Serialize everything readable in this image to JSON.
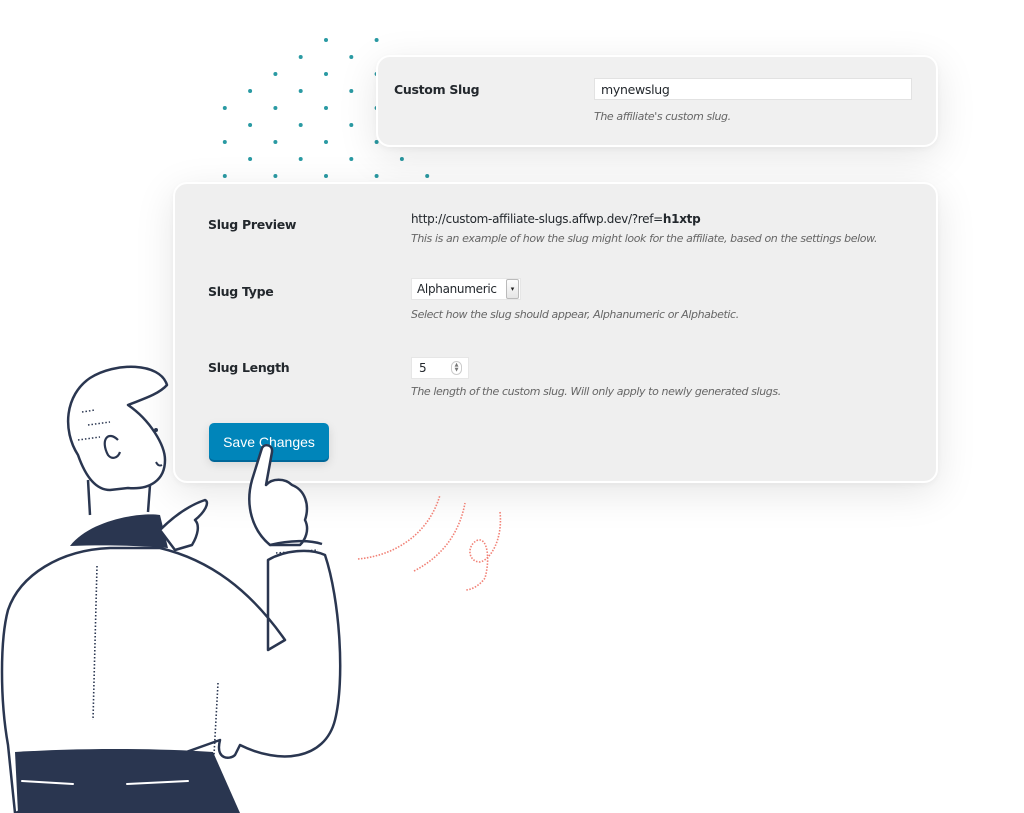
{
  "colors": {
    "accent": "#0085ba",
    "dots": "#2a9aa3",
    "figure_outline": "#2a3650",
    "motion_lines": "#ef6b5e"
  },
  "custom_slug": {
    "label": "Custom Slug",
    "value": "mynewslug",
    "description": "The affiliate's custom slug."
  },
  "settings": {
    "slug_preview": {
      "label": "Slug Preview",
      "url_prefix": "http://custom-affiliate-slugs.affwp.dev/?ref=",
      "url_ref": "h1xtp",
      "description": "This is an example of how the slug might look for the affiliate, based on the settings below."
    },
    "slug_type": {
      "label": "Slug Type",
      "selected": "Alphanumeric",
      "description": "Select how the slug should appear, Alphanumeric or Alphabetic."
    },
    "slug_length": {
      "label": "Slug Length",
      "value": "5",
      "description": "The length of the custom slug. Will only apply to newly generated slugs."
    },
    "save_label": "Save Changes"
  },
  "icons": {
    "select_arrow": "▾",
    "spin_up": "▲",
    "spin_down": "▼"
  }
}
